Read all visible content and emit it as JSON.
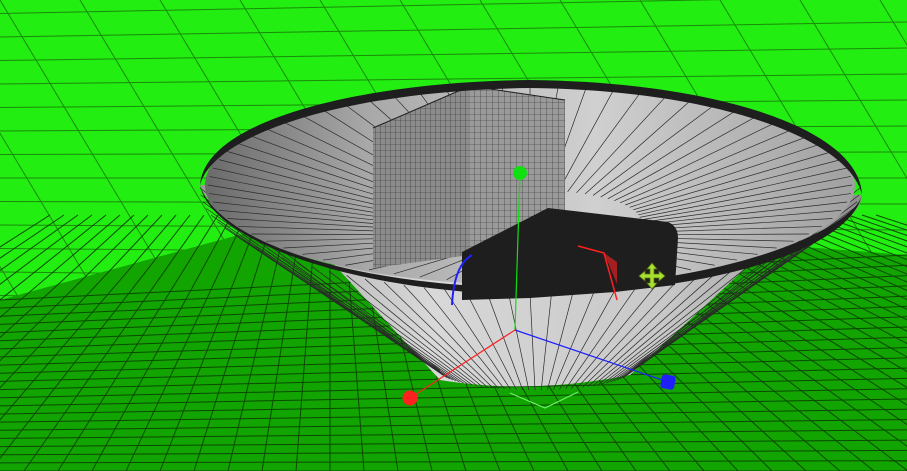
{
  "viewport": {
    "background_color": "#22ee11",
    "ground_color": "#12a400",
    "grid_line_color": "#0a4a00"
  },
  "scene_objects": [
    {
      "name": "cone-bowl",
      "kind": "frustum",
      "fill": "#c4c4c4",
      "edge_color": "#1e1e1e"
    },
    {
      "name": "wireframe-box",
      "kind": "box",
      "fill": "#888888",
      "edge_color": "#1e1e1e"
    },
    {
      "name": "black-box",
      "kind": "box",
      "fill": "#1e1e1e"
    }
  ],
  "gizmo": {
    "x_axis_color": "#ff2020",
    "y_axis_color": "#10e010",
    "z_axis_color": "#2020ff",
    "move_handle_color": "#a8e030",
    "move_handle_icon": "move-arrows-icon",
    "plane_handle_color": "#70f070"
  }
}
